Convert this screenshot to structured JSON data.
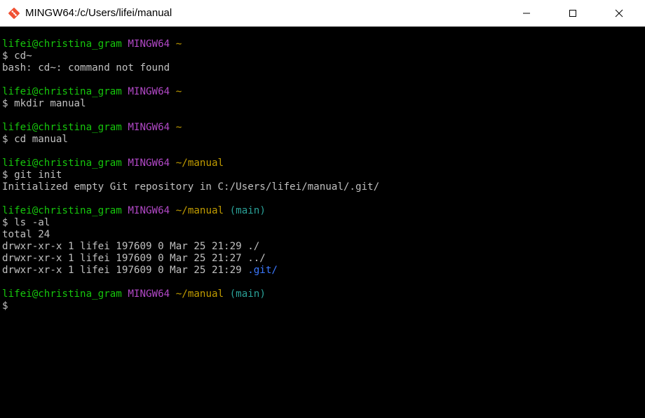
{
  "window": {
    "title": "MINGW64:/c/Users/lifei/manual",
    "minimize_icon": "minimize-icon",
    "maximize_icon": "maximize-icon",
    "close_icon": "close-icon",
    "app_icon": "git-diamond-icon"
  },
  "colors": {
    "prompt_user": "#16c60c",
    "prompt_shell": "#b148c6",
    "prompt_path": "#c19c00",
    "prompt_branch": "#2aa198",
    "dir_entry": "#3b78ff",
    "text": "#c0c0c0"
  },
  "terminal": {
    "p1_user": "lifei@christina_gram",
    "p1_shell": "MINGW64",
    "p1_path": "~",
    "cmd1": "$ cd~",
    "out1": "bash: cd~: command not found",
    "p2_user": "lifei@christina_gram",
    "p2_shell": "MINGW64",
    "p2_path": "~",
    "cmd2": "$ mkdir manual",
    "p3_user": "lifei@christina_gram",
    "p3_shell": "MINGW64",
    "p3_path": "~",
    "cmd3": "$ cd manual",
    "p4_user": "lifei@christina_gram",
    "p4_shell": "MINGW64",
    "p4_path": "~/manual",
    "cmd4": "$ git init",
    "out4": "Initialized empty Git repository in C:/Users/lifei/manual/.git/",
    "p5_user": "lifei@christina_gram",
    "p5_shell": "MINGW64",
    "p5_path": "~/manual",
    "p5_branch": "(main)",
    "cmd5": "$ ls -al",
    "out5_total": "total 24",
    "ls_rows": [
      {
        "meta": "drwxr-xr-x 1 lifei 197609 0 Mar 25 21:29",
        "name": "./"
      },
      {
        "meta": "drwxr-xr-x 1 lifei 197609 0 Mar 25 21:27",
        "name": "../"
      },
      {
        "meta": "drwxr-xr-x 1 lifei 197609 0 Mar 25 21:29",
        "name": ".git/"
      }
    ],
    "p6_user": "lifei@christina_gram",
    "p6_shell": "MINGW64",
    "p6_path": "~/manual",
    "p6_branch": "(main)",
    "cmd6": "$"
  }
}
